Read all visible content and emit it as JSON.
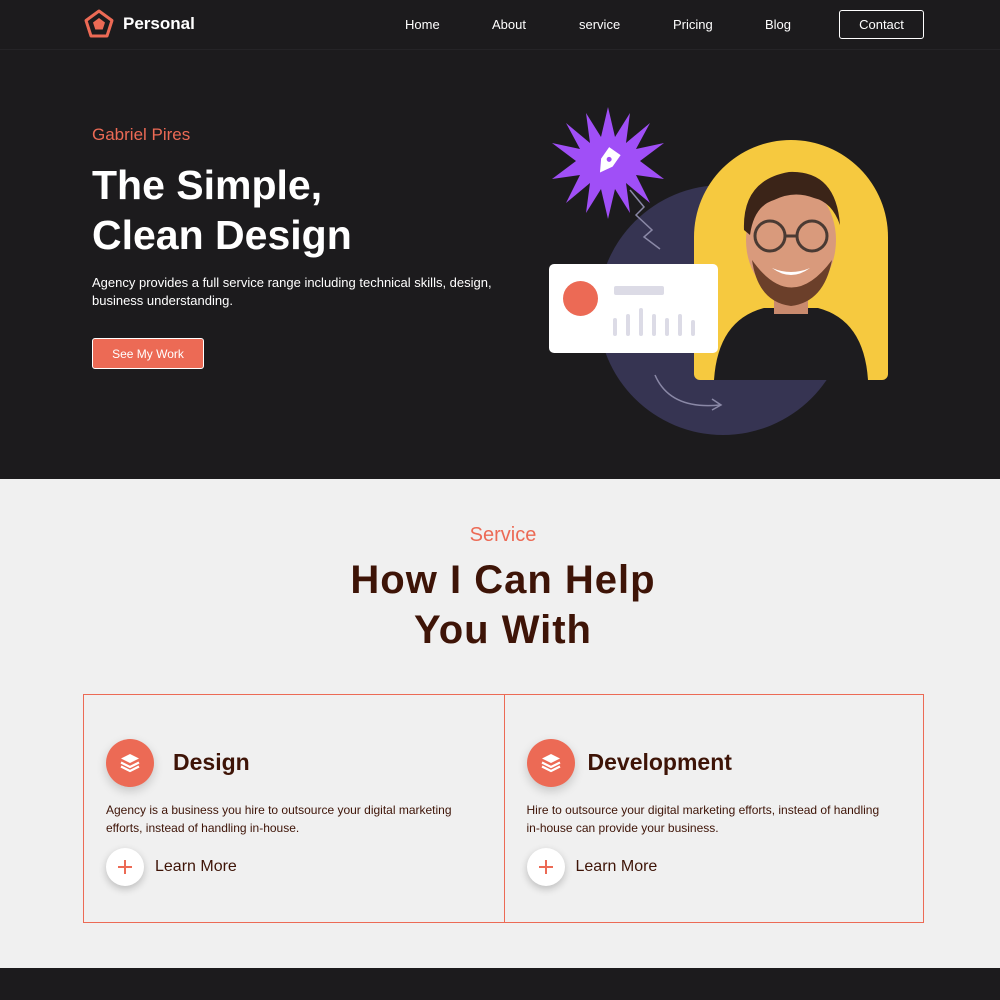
{
  "colors": {
    "accent": "#ec6a55",
    "dark": "#1c1b1d",
    "brown": "#3e1407",
    "yellow": "#f6c93f",
    "navy": "#363452",
    "purple": "#a04ff7"
  },
  "nav": {
    "brand": "Personal",
    "links": [
      "Home",
      "About",
      "service",
      "Pricing",
      "Blog"
    ],
    "contact": "Contact"
  },
  "hero": {
    "name": "Gabriel Pires",
    "title_line1": "The Simple,",
    "title_line2": "Clean Design",
    "description": "Agency provides a full service range including technical skills, design, business understanding.",
    "button": "See My Work"
  },
  "services": {
    "kicker": "Service",
    "title_line1": "How I Can Help",
    "title_line2": "You With",
    "items": [
      {
        "icon": "layers-icon",
        "name": "Design",
        "description": "Agency is a business you hire to outsource your digital marketing efforts, instead of handling in-house.",
        "cta": "Learn More"
      },
      {
        "icon": "layers-icon",
        "name": "Development",
        "description": "Hire to outsource your digital marketing efforts, instead of handling in-house can provide your business.",
        "cta": "Learn More"
      }
    ]
  }
}
